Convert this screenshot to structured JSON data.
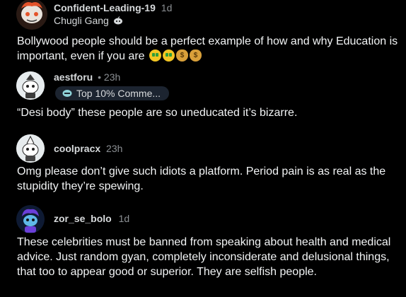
{
  "post": {
    "author": "Confident-Leading-19",
    "time": "1d",
    "community": "Chugli Gang",
    "community_icon": "robot-icon",
    "body": "Bollywood people should be a perfect example of how and why Education is important, even if you are",
    "emojis": [
      "money-mouth-face",
      "money-mouth-face",
      "money-bag",
      "money-bag"
    ]
  },
  "comments": [
    {
      "author": "aestforu",
      "time": "• 23h",
      "badge": "Top 10% Comme...",
      "badge_icon": "comment-award-icon",
      "body": "“Desi body” these people are so uneducated it’s bizarre."
    },
    {
      "author": "coolpracx",
      "time": "23h",
      "body": "Omg please don’t give such idiots a platform. Period pain is as real as the stupidity they’re spewing."
    },
    {
      "author": "zor_se_bolo",
      "time": "1d",
      "body": "These celebrities must be banned from speaking about health and medical advice.  Just random gyan, completely inconsiderate and delusional things, that too to appear good or superior. They are selfish people."
    }
  ],
  "colors": {
    "background": "#000000",
    "text": "#f2f4f5",
    "meta": "#8b8f93",
    "badge_bg": "#1c2430"
  }
}
